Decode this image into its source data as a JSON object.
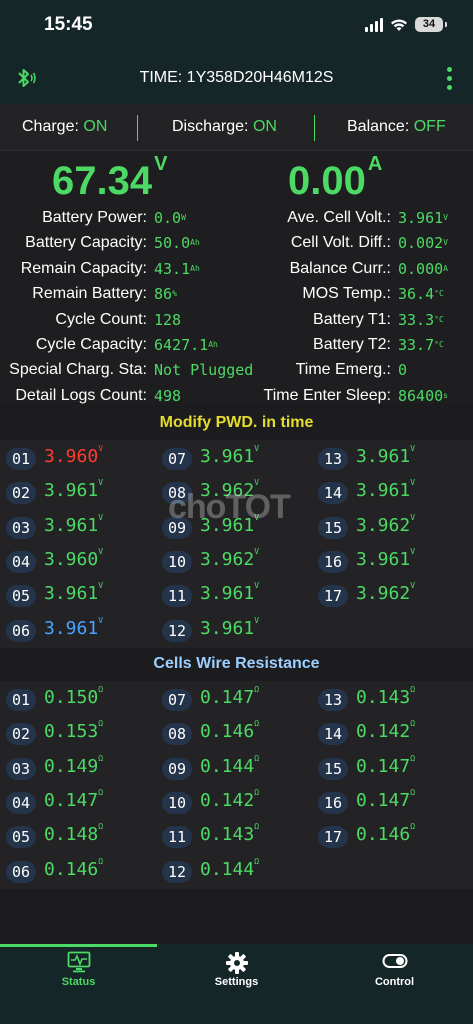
{
  "status_bar": {
    "time": "15:45",
    "battery": "34"
  },
  "header": {
    "title": "TIME: 1Y358D20H46M12S"
  },
  "toggles": [
    {
      "label": "Charge:",
      "value": "ON"
    },
    {
      "label": "Discharge:",
      "value": "ON"
    },
    {
      "label": "Balance:",
      "value": "OFF"
    }
  ],
  "summary": {
    "voltage": "67.34",
    "voltage_unit": "V",
    "current": "0.00",
    "current_unit": "A"
  },
  "left_stats": [
    {
      "label": "Battery Power:",
      "value": "0.0",
      "unit": "W"
    },
    {
      "label": "Battery Capacity:",
      "value": "50.0",
      "unit": "Ah"
    },
    {
      "label": "Remain Capacity:",
      "value": "43.1",
      "unit": "Ah"
    },
    {
      "label": "Remain Battery:",
      "value": "86",
      "unit": "%"
    },
    {
      "label": "Cycle Count:",
      "value": "128",
      "unit": ""
    },
    {
      "label": "Cycle Capacity:",
      "value": "6427.1",
      "unit": "Ah"
    },
    {
      "label": "Special Charg. Sta:",
      "value": "Not Plugged",
      "unit": ""
    },
    {
      "label": "Detail Logs Count:",
      "value": "498",
      "unit": ""
    }
  ],
  "right_stats": [
    {
      "label": "Ave. Cell Volt.:",
      "value": "3.961",
      "unit": "V"
    },
    {
      "label": "Cell Volt. Diff.:",
      "value": "0.002",
      "unit": "V"
    },
    {
      "label": "Balance Curr.:",
      "value": "0.000",
      "unit": "A"
    },
    {
      "label": "MOS Temp.:",
      "value": "36.4",
      "unit": "°C"
    },
    {
      "label": "Battery T1:",
      "value": "33.3",
      "unit": "°C"
    },
    {
      "label": "Battery T2:",
      "value": "33.7",
      "unit": "°C"
    },
    {
      "label": "Time Emerg.:",
      "value": "0",
      "unit": ""
    },
    {
      "label": "Time Enter Sleep:",
      "value": "86400",
      "unit": "s"
    }
  ],
  "cells_title": "Modify PWD. in time",
  "cells_unit": "V",
  "cells": [
    {
      "id": "01",
      "value": "3.960",
      "color": "red"
    },
    {
      "id": "02",
      "value": "3.961",
      "color": "green"
    },
    {
      "id": "03",
      "value": "3.961",
      "color": "green"
    },
    {
      "id": "04",
      "value": "3.960",
      "color": "green"
    },
    {
      "id": "05",
      "value": "3.961",
      "color": "green"
    },
    {
      "id": "06",
      "value": "3.961",
      "color": "blue"
    },
    {
      "id": "07",
      "value": "3.961",
      "color": "green"
    },
    {
      "id": "08",
      "value": "3.962",
      "color": "green"
    },
    {
      "id": "09",
      "value": "3.961",
      "color": "green"
    },
    {
      "id": "10",
      "value": "3.962",
      "color": "green"
    },
    {
      "id": "11",
      "value": "3.961",
      "color": "green"
    },
    {
      "id": "12",
      "value": "3.961",
      "color": "green"
    },
    {
      "id": "13",
      "value": "3.961",
      "color": "green"
    },
    {
      "id": "14",
      "value": "3.961",
      "color": "green"
    },
    {
      "id": "15",
      "value": "3.962",
      "color": "green"
    },
    {
      "id": "16",
      "value": "3.961",
      "color": "green"
    },
    {
      "id": "17",
      "value": "3.962",
      "color": "green"
    }
  ],
  "resistance_title": "Cells Wire Resistance",
  "resistance_unit": "Ω",
  "resistances": [
    {
      "id": "01",
      "value": "0.150"
    },
    {
      "id": "02",
      "value": "0.153"
    },
    {
      "id": "03",
      "value": "0.149"
    },
    {
      "id": "04",
      "value": "0.147"
    },
    {
      "id": "05",
      "value": "0.148"
    },
    {
      "id": "06",
      "value": "0.146"
    },
    {
      "id": "07",
      "value": "0.147"
    },
    {
      "id": "08",
      "value": "0.146"
    },
    {
      "id": "09",
      "value": "0.144"
    },
    {
      "id": "10",
      "value": "0.142"
    },
    {
      "id": "11",
      "value": "0.143"
    },
    {
      "id": "12",
      "value": "0.144"
    },
    {
      "id": "13",
      "value": "0.143"
    },
    {
      "id": "14",
      "value": "0.142"
    },
    {
      "id": "15",
      "value": "0.147"
    },
    {
      "id": "16",
      "value": "0.147"
    },
    {
      "id": "17",
      "value": "0.146"
    }
  ],
  "watermark": "choTOT",
  "tabs": [
    {
      "label": "Status",
      "icon": "monitor-pulse-icon",
      "active": true
    },
    {
      "label": "Settings",
      "icon": "gear-icon",
      "active": false
    },
    {
      "label": "Control",
      "icon": "toggle-icon",
      "active": false
    }
  ],
  "colors": {
    "accent_green": "#4cd964",
    "alert_red": "#ff3b30",
    "info_blue": "#4aa3ff",
    "section_yellow": "#e3dc2f",
    "section_blue": "#9ccfff",
    "header_bg": "#152629"
  }
}
